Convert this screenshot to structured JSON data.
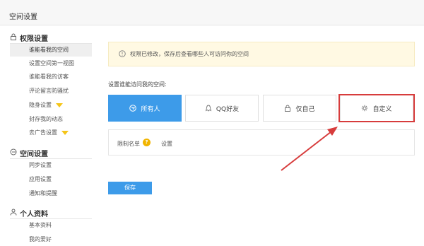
{
  "header": {
    "title": "空间设置"
  },
  "sidebar": {
    "sections": [
      {
        "title": "权限设置",
        "icon": "lock-icon",
        "items": [
          {
            "label": "谁能看我的空间",
            "active": true
          },
          {
            "label": "设置空间第一视图"
          },
          {
            "label": "谁能看我的访客"
          },
          {
            "label": "评论留言防骚扰"
          },
          {
            "label": "隐身设置",
            "badge": "vip-diamond-icon"
          },
          {
            "label": "封存我的动态"
          },
          {
            "label": "去广告设置",
            "badge": "vip-diamond-icon"
          }
        ]
      },
      {
        "title": "空间设置",
        "icon": "space-icon",
        "items": [
          {
            "label": "同步设置"
          },
          {
            "label": "应用设置"
          },
          {
            "label": "通知和提醒"
          }
        ]
      },
      {
        "title": "个人资料",
        "icon": "profile-icon",
        "items": [
          {
            "label": "基本资料"
          },
          {
            "label": "我的爱好"
          }
        ]
      }
    ]
  },
  "notice": {
    "text": "权限已修改，保存后查看哪些人可访问你的空间",
    "icon": "info-icon"
  },
  "access": {
    "label": "设置谁能访问我的空间:",
    "options": [
      {
        "label": "所有人",
        "icon": "globe-icon",
        "selected": true
      },
      {
        "label": "QQ好友",
        "icon": "qq-penguin-icon"
      },
      {
        "label": "仅自己",
        "icon": "lock-icon"
      },
      {
        "label": "自定义",
        "icon": "gear-icon",
        "highlighted": true
      }
    ]
  },
  "limit": {
    "label": "限制名单",
    "help": "?",
    "action": "设置"
  },
  "save_label": "保存",
  "colors": {
    "accent": "#3d9be9",
    "highlight": "#d73c3c",
    "notice_bg": "#fff9e3"
  }
}
